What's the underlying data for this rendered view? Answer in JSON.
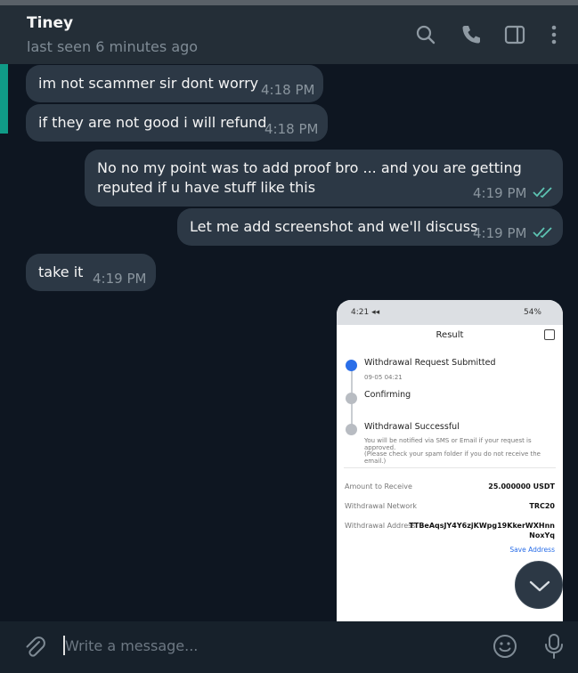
{
  "header": {
    "name": "Tiney",
    "status": "last seen 6 minutes ago"
  },
  "messages": [
    {
      "dir": "in",
      "text": "im not scammer sir dont worry",
      "time": "4:18 PM"
    },
    {
      "dir": "in",
      "text": "if they are not good i will refund",
      "time": "4:18 PM"
    },
    {
      "dir": "out",
      "line1": "No no my point was to add proof bro ... and you are getting",
      "line2": "reputed if u have stuff like this",
      "time": "4:19 PM"
    },
    {
      "dir": "out",
      "text": "Let me add screenshot and we'll discuss",
      "time": "4:19 PM"
    },
    {
      "dir": "in",
      "text": "take it",
      "time": "4:19 PM"
    }
  ],
  "screenshot": {
    "status_left": "4:21 ◂◂",
    "status_right": "54%",
    "title": "Result",
    "steps": [
      {
        "label": "Withdrawal Request Submitted",
        "sub": "09-05 04:21"
      },
      {
        "label": "Confirming",
        "sub": ""
      },
      {
        "label": "Withdrawal Successful",
        "sub": "You will be notified via SMS or Email if your request is approved.",
        "sub2": "(Please check your spam folder if you do not receive the email.)"
      }
    ],
    "rows": [
      {
        "label": "Amount to Receive",
        "value": "25.000000 USDT"
      },
      {
        "label": "Withdrawal Network",
        "value": "TRC20"
      },
      {
        "label": "Withdrawal Address",
        "value": "TTBeAqsJY4Y6zjKWpg19KkerWXHnn",
        "value2": "NoxYq"
      }
    ],
    "save_label": "Save Address"
  },
  "composer": {
    "placeholder": "Write a message..."
  },
  "colors": {
    "header_bg": "#242e37",
    "chat_bg": "#0e1621",
    "bubble_bg": "#2c3845",
    "accent": "#109b87",
    "read_check": "#5dc3b2"
  }
}
